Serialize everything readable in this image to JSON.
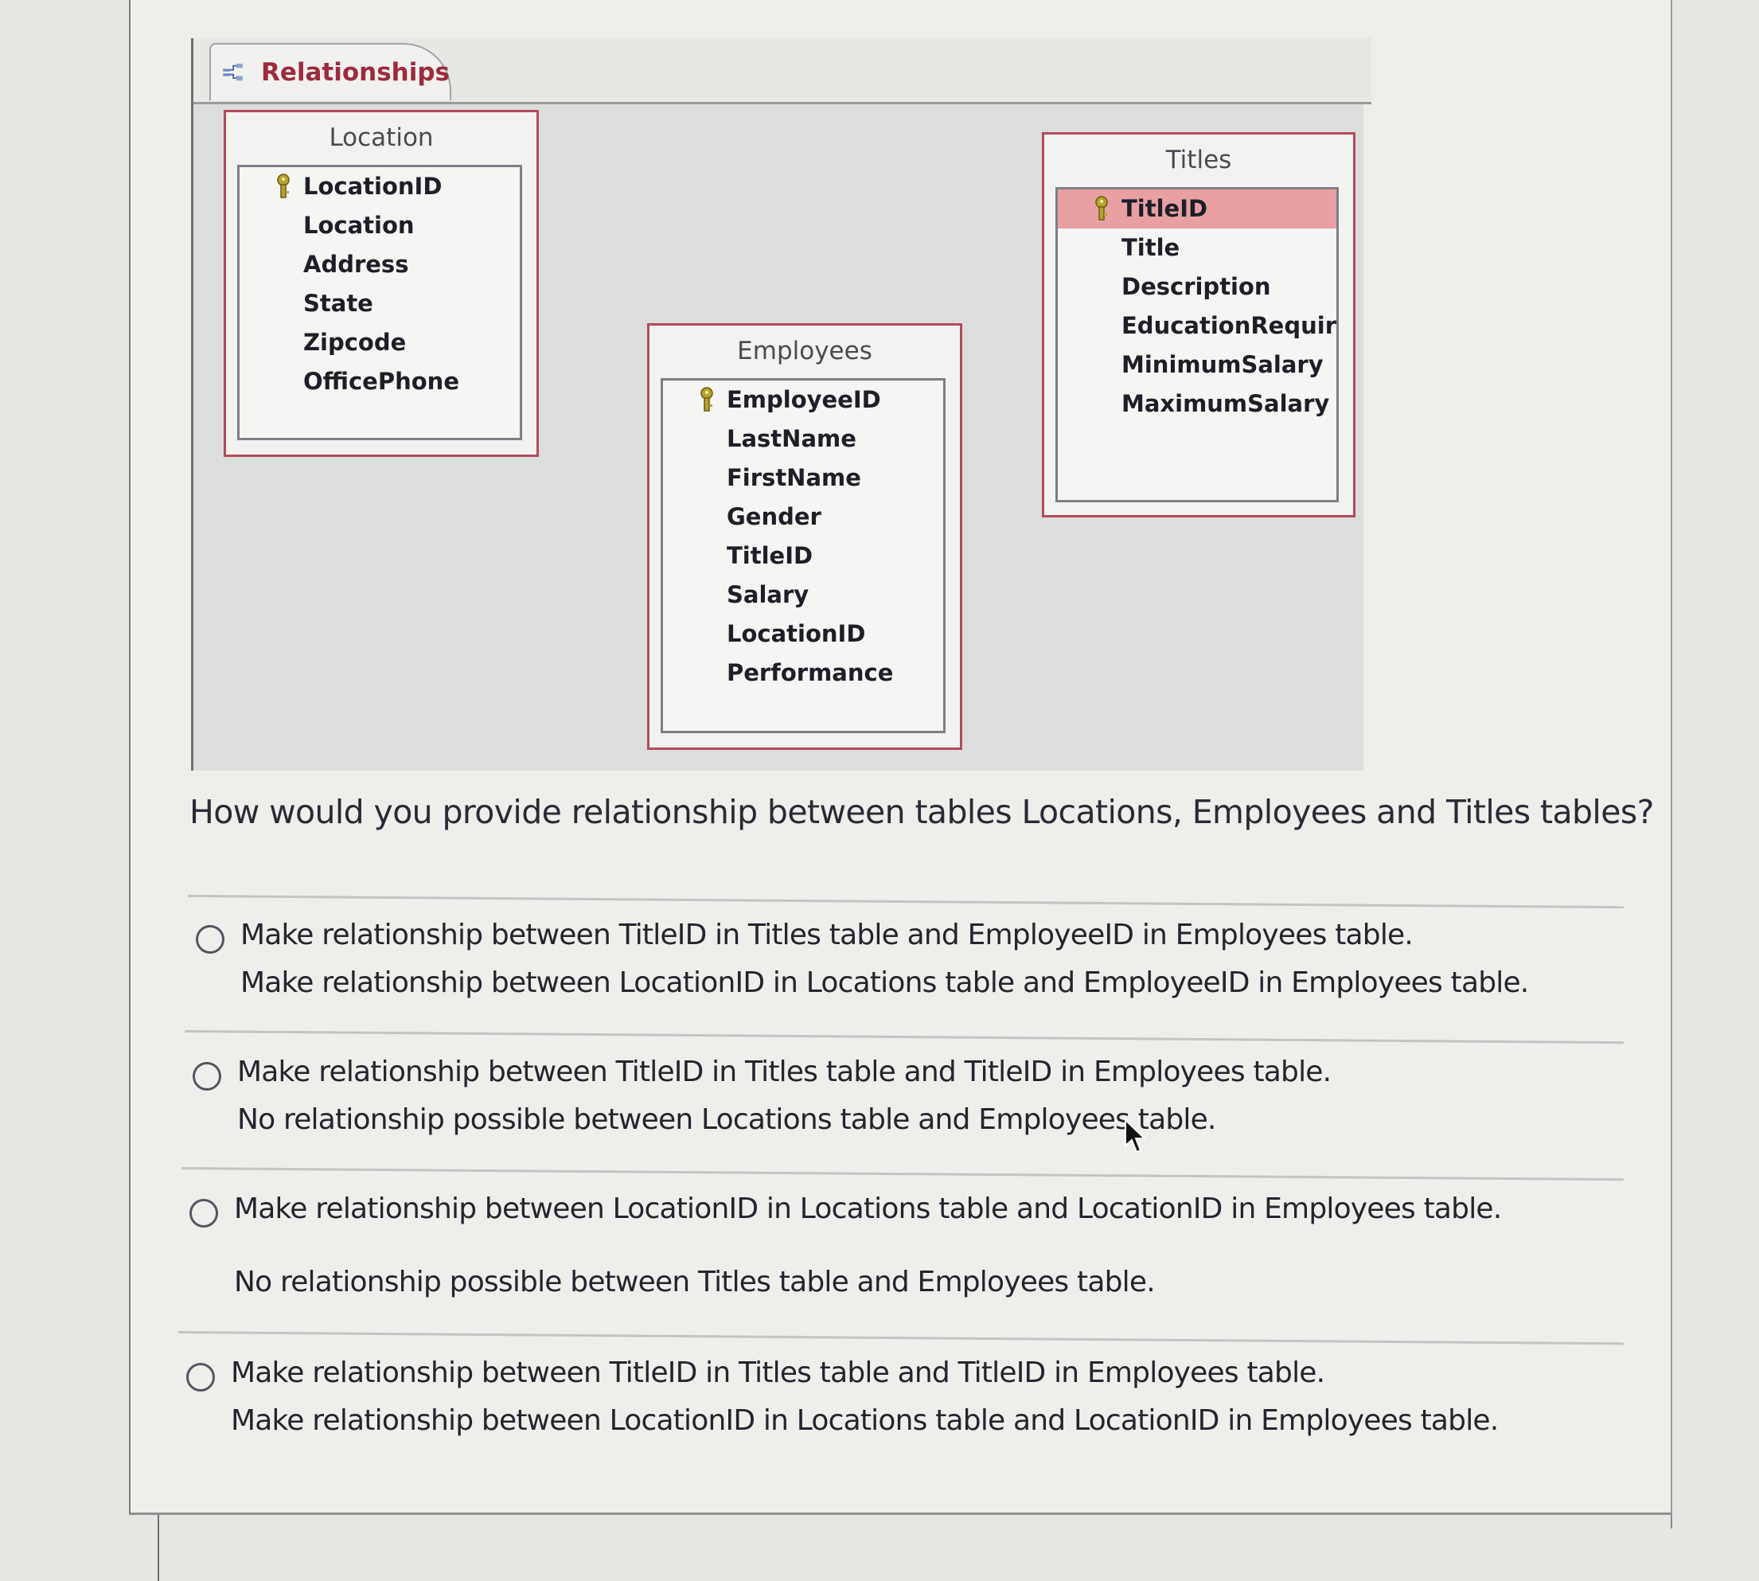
{
  "window": {
    "tab_label": "Relationships",
    "tab_icon": "relationships-icon"
  },
  "tables": [
    {
      "name": "Location",
      "primary_key": "LocationID",
      "fields": [
        "LocationID",
        "Location",
        "Address",
        "State",
        "Zipcode",
        "OfficePhone"
      ],
      "selected_field": null
    },
    {
      "name": "Employees",
      "primary_key": "EmployeeID",
      "fields": [
        "EmployeeID",
        "LastName",
        "FirstName",
        "Gender",
        "TitleID",
        "Salary",
        "LocationID",
        "Performance"
      ],
      "selected_field": null
    },
    {
      "name": "Titles",
      "primary_key": "TitleID",
      "fields": [
        "TitleID",
        "Title",
        "Description",
        "EducationRequired",
        "MinimumSalary",
        "MaximumSalary"
      ],
      "selected_field": "TitleID"
    }
  ],
  "question": {
    "text": "How would you provide  relationship between tables Locations, Employees and Titles tables?"
  },
  "options": [
    {
      "selected": false,
      "lines": [
        "Make relationship between TitleID in Titles table and EmployeeID in Employees table.",
        "Make relationship between LocationID in Locations table and EmployeeID in Employees table."
      ]
    },
    {
      "selected": false,
      "lines": [
        "Make relationship between TitleID in Titles table and TitleID in Employees table.",
        "No relationship possible between Locations table and Employees table."
      ]
    },
    {
      "selected": false,
      "lines": [
        "Make relationship between LocationID in Locations table and LocationID in Employees table.",
        "No relationship possible between Titles table and Employees table."
      ]
    },
    {
      "selected": false,
      "lines": [
        "Make relationship between TitleID in Titles table and TitleID in Employees table.",
        "Make relationship between LocationID in Locations table and LocationID in Employees table."
      ]
    }
  ],
  "colors": {
    "table_border": "#b44a5a",
    "tab_label": "#9c2b3c",
    "selected_field_bg": "#e8a0a2",
    "key_icon": "#b8a230"
  }
}
